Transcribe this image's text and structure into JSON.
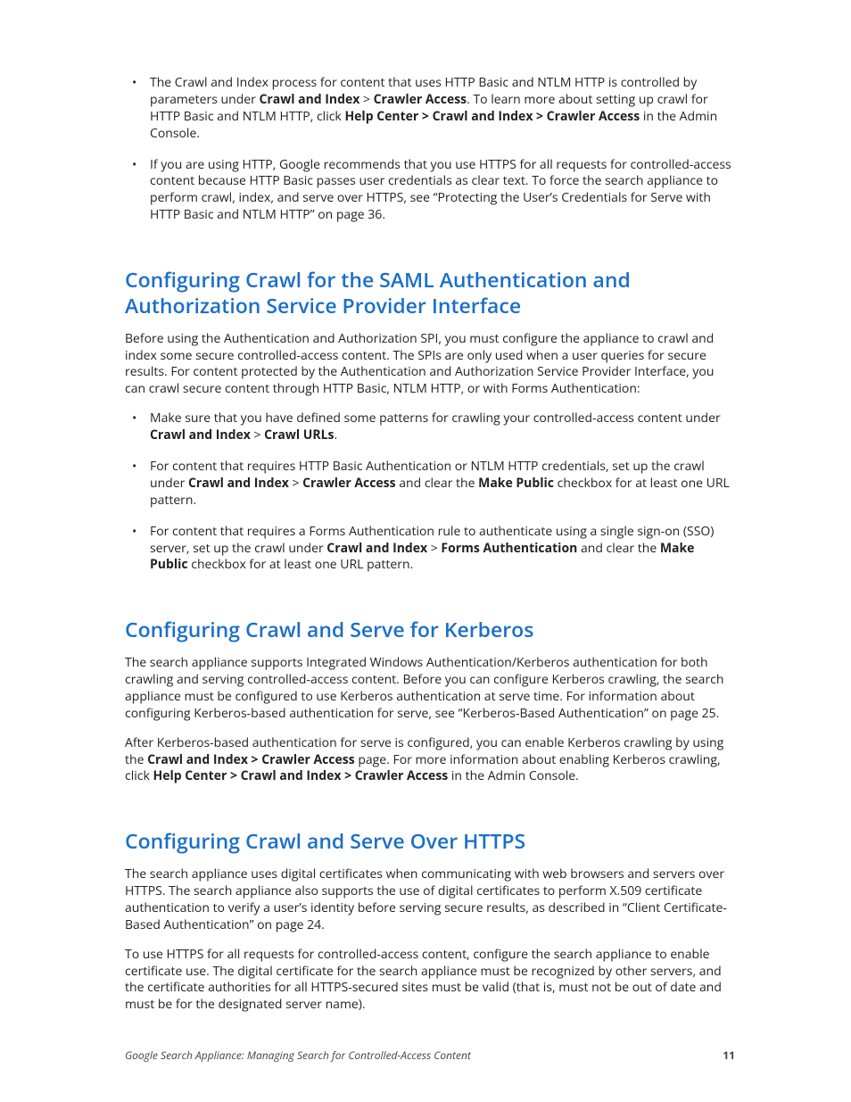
{
  "top_bullets": {
    "b1": {
      "t1": "The Crawl and Index process for content that uses HTTP Basic and NTLM HTTP is controlled by parameters under ",
      "b1": "Crawl and Index",
      "t2": " > ",
      "b2": "Crawler Access",
      "t3": ". To learn more about setting up crawl for HTTP Basic and NTLM HTTP, click ",
      "b3": "Help Center > Crawl and Index > Crawler Access",
      "t4": " in the Admin Console."
    },
    "b2": {
      "t1": "If you are using HTTP, Google recommends that you use HTTPS for all requests for controlled-access content because HTTP Basic passes user credentials as clear text. To force the search appliance to perform crawl, index, and serve over HTTPS, see “Protecting the User’s Credentials for Serve with HTTP Basic and NTLM HTTP” on page 36."
    }
  },
  "section1": {
    "heading": "Configuring Crawl for the SAML Authentication and Authorization Service Provider Interface",
    "p1": "Before using the Authentication and Authorization SPI, you must configure the appliance to crawl and index some secure controlled-access content. The SPIs are only used when a user queries for secure results. For content protected by the Authentication and Authorization Service Provider Interface, you can crawl secure content through HTTP Basic, NTLM HTTP, or with Forms Authentication:",
    "bullets": {
      "b1": {
        "t1": "Make sure that you have defined some patterns for crawling your controlled-access content under ",
        "b1": "Crawl and Index",
        "t2": " > ",
        "b2": "Crawl URLs",
        "t3": "."
      },
      "b2": {
        "t1": "For content that requires HTTP Basic Authentication or NTLM HTTP credentials, set up the crawl under ",
        "b1": "Crawl and Index",
        "t2": " > ",
        "b2": "Crawler Access",
        "t3": " and clear the ",
        "b3": "Make Public",
        "t4": " checkbox for at least one URL pattern."
      },
      "b3": {
        "t1": "For content that requires a Forms Authentication rule to authenticate using a single sign-on (SSO) server, set up the crawl under ",
        "b1": "Crawl and Index",
        "t2": " > ",
        "b2": "Forms Authentication",
        "t3": " and clear the ",
        "b3": "Make Public",
        "t4": " checkbox for at least one URL pattern."
      }
    }
  },
  "section2": {
    "heading": "Configuring Crawl and Serve for Kerberos",
    "p1": "The search appliance supports Integrated Windows Authentication/Kerberos authentication for both crawling and serving controlled-access content. Before you can configure Kerberos crawling, the search appliance must be configured to use Kerberos authentication at serve time. For information about configuring Kerberos-based authentication for serve, see “Kerberos-Based Authentication” on page 25.",
    "p2": {
      "t1": "After Kerberos-based authentication for serve is configured, you can enable Kerberos crawling by using the ",
      "b1": "Crawl and Index > Crawler Access",
      "t2": " page. For more information about enabling Kerberos crawling, click ",
      "b2": "Help Center > Crawl and Index > Crawler Access",
      "t3": " in the Admin Console."
    }
  },
  "section3": {
    "heading": "Configuring Crawl and Serve Over HTTPS",
    "p1": "The search appliance uses digital certificates when communicating with web browsers and servers over HTTPS. The search appliance also supports the use of digital certificates to perform X.509 certificate authentication to verify a user’s identity before serving secure results, as described in “Client Certificate-Based Authentication” on page 24.",
    "p2": "To use HTTPS for all requests for controlled-access content, configure the search appliance to enable certificate use. The digital certificate for the search appliance must be recognized by other servers, and the certificate authorities for all HTTPS-secured sites must be valid (that is, must not be out of date and must be for the designated server name)."
  },
  "footer": {
    "title": "Google Search Appliance: Managing Search for Controlled-Access Content",
    "page": "11"
  }
}
